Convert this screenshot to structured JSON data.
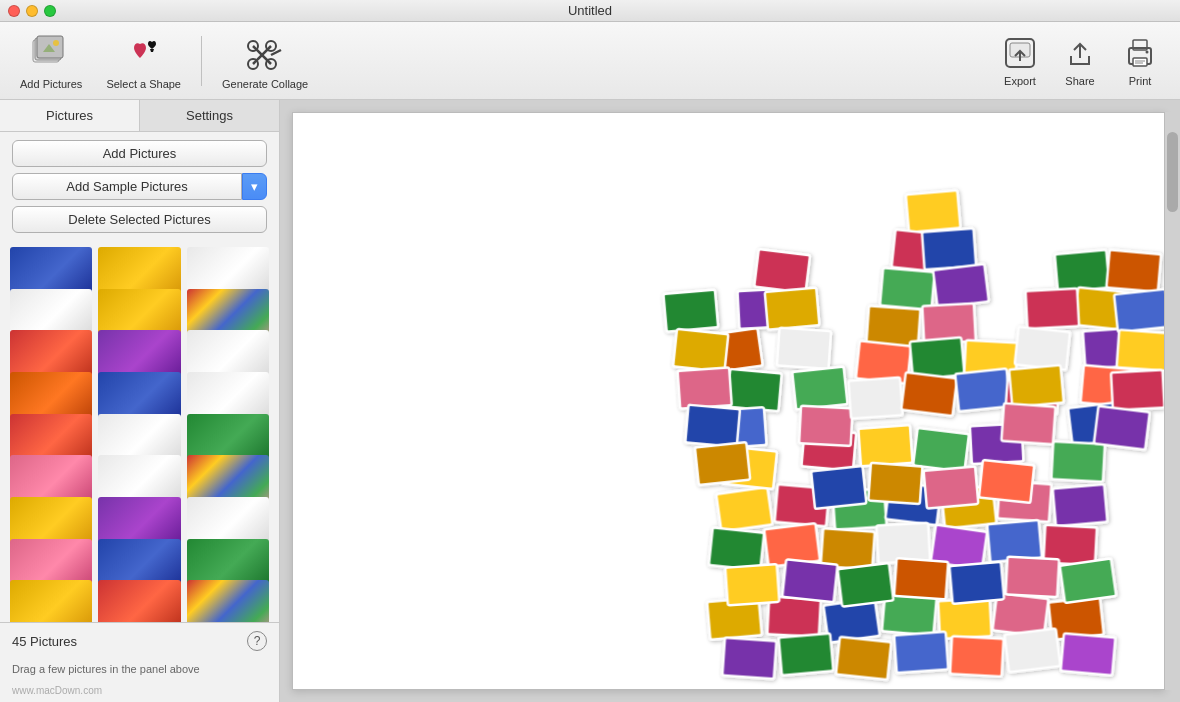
{
  "window": {
    "title": "Untitled"
  },
  "toolbar": {
    "add_pictures_label": "Add Pictures",
    "select_shape_label": "Select a Shape",
    "generate_collage_label": "Generate Collage",
    "export_label": "Export",
    "share_label": "Share",
    "print_label": "Print"
  },
  "sidebar": {
    "tab_pictures": "Pictures",
    "tab_settings": "Settings",
    "btn_add_pictures": "Add Pictures",
    "btn_add_sample": "Add Sample Pictures",
    "btn_delete": "Delete Selected Pictures",
    "pictures_count": "45 Pictures",
    "help_symbol": "?",
    "hint_text": "Drag a few pictures in the panel above",
    "watermark": "www.macDown.com"
  },
  "thumbs": [
    {
      "color": "thumb-blue",
      "id": 1
    },
    {
      "color": "thumb-yellow",
      "id": 2
    },
    {
      "color": "thumb-white",
      "id": 3
    },
    {
      "color": "thumb-white",
      "id": 4
    },
    {
      "color": "thumb-yellow",
      "id": 5
    },
    {
      "color": "thumb-multi",
      "id": 6
    },
    {
      "color": "thumb-red",
      "id": 7
    },
    {
      "color": "thumb-purple",
      "id": 8
    },
    {
      "color": "thumb-white",
      "id": 9
    },
    {
      "color": "thumb-orange",
      "id": 10
    },
    {
      "color": "thumb-blue",
      "id": 11
    },
    {
      "color": "thumb-white",
      "id": 12
    },
    {
      "color": "thumb-red",
      "id": 13
    },
    {
      "color": "thumb-white",
      "id": 14
    },
    {
      "color": "thumb-green",
      "id": 15
    },
    {
      "color": "thumb-pink",
      "id": 16
    },
    {
      "color": "thumb-white",
      "id": 17
    },
    {
      "color": "thumb-multi",
      "id": 18
    },
    {
      "color": "thumb-yellow",
      "id": 19
    },
    {
      "color": "thumb-purple",
      "id": 20
    },
    {
      "color": "thumb-white",
      "id": 21
    },
    {
      "color": "thumb-pink",
      "id": 22
    },
    {
      "color": "thumb-blue",
      "id": 23
    },
    {
      "color": "thumb-green",
      "id": 24
    },
    {
      "color": "thumb-yellow",
      "id": 25
    },
    {
      "color": "thumb-red",
      "id": 26
    },
    {
      "color": "thumb-multi",
      "id": 27
    }
  ]
}
